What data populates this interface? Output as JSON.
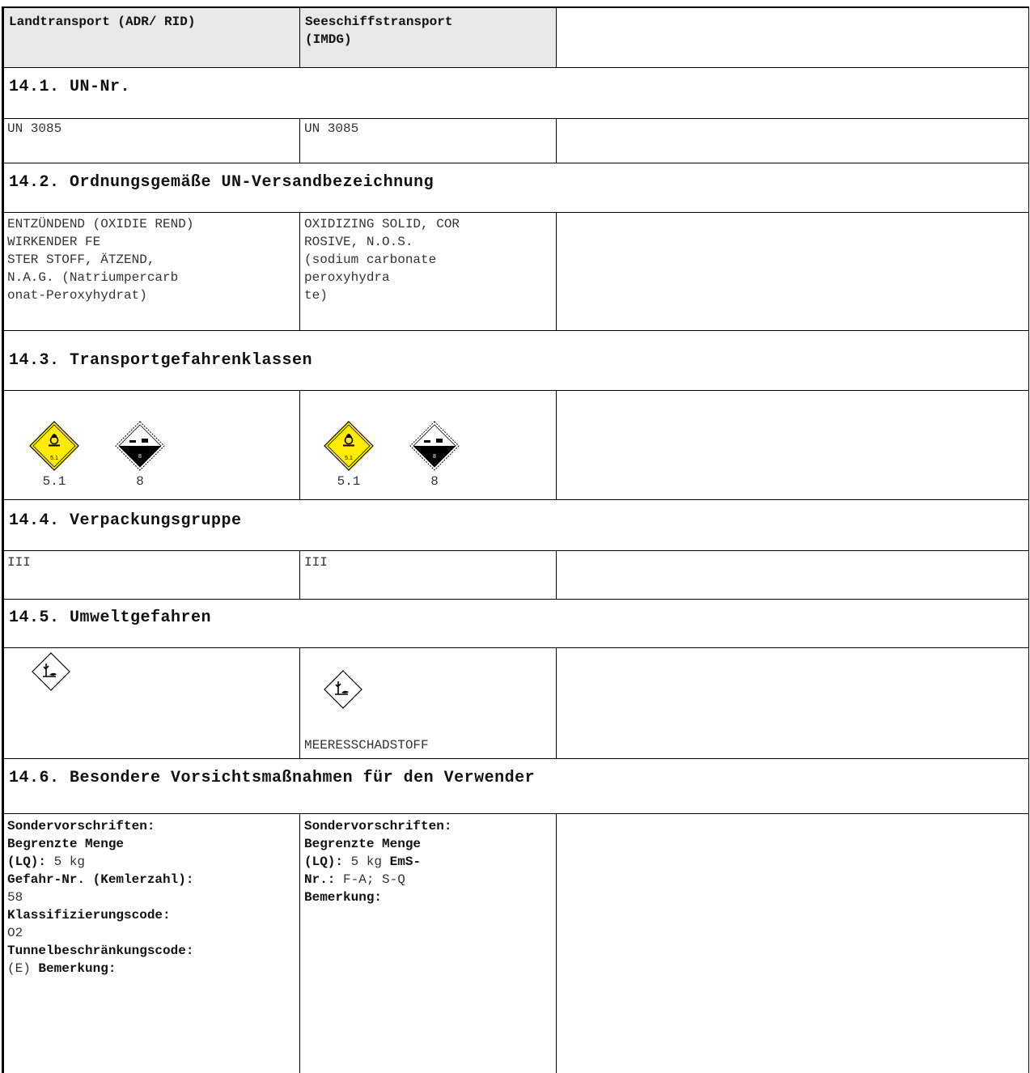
{
  "columns": {
    "land": "Landtransport (ADR/ RID)",
    "sea": "Seeschiffstransport\n(IMDG)"
  },
  "sections": {
    "un_nr": {
      "title": "14.1. UN-Nr.",
      "land": "UN 3085",
      "sea": "UN 3085"
    },
    "shipping_name": {
      "title": "14.2. Ordnungsgemäße UN-Versandbezeichnung",
      "land": "ENTZÜNDEND (OXIDIE REND)\nWIRKENDER FE\nSTER STOFF, ÄTZEND,\nN.A.G. (Natriumpercarb\nonat-Peroxyhydrat)",
      "sea": "OXIDIZING SOLID, COR\nROSIVE, N.O.S.\n(sodium carbonate\nperoxyhydra\nte)"
    },
    "hazard_classes": {
      "title": "14.3. Transportgefahrenklassen",
      "land_codes": [
        "5.1",
        "8"
      ],
      "sea_codes": [
        "5.1",
        "8"
      ],
      "pictograms": [
        "oxidizer-5-1-icon",
        "corrosive-8-icon"
      ]
    },
    "packing_group": {
      "title": "14.4. Verpackungsgruppe",
      "land": "III",
      "sea": "III"
    },
    "environment": {
      "title": "14.5. Umweltgefahren",
      "sea_label": "MEERESSCHADSTOFF",
      "pictogram": "environment-hazard-icon"
    },
    "precautions": {
      "title": "14.6. Besondere Vorsichtsmaßnahmen für den Verwender",
      "land": {
        "special_provisions_label": "Sondervorschriften:",
        "limited_qty_label_1": "Begrenzte Menge",
        "limited_qty_label_2": "(LQ):",
        "limited_qty_value": "5 kg",
        "hazard_no_label": "Gefahr-Nr. (Kemlerzahl):",
        "hazard_no_value": "58",
        "classification_label": "Klassifizierungscode:",
        "classification_value": "O2",
        "tunnel_label": "Tunnelbeschränkungscode:",
        "tunnel_value": "(E)",
        "remark_label": "Bemerkung:"
      },
      "sea": {
        "special_provisions_label": "Sondervorschriften:",
        "limited_qty_label_1": "Begrenzte Menge",
        "limited_qty_label_2": "(LQ):",
        "limited_qty_value": "5 kg",
        "ems_label_1": "EmS-",
        "ems_label_2": "Nr.:",
        "ems_value": "F-A; S-Q",
        "remark_label": "Bemerkung:"
      }
    }
  },
  "colors": {
    "header_bg": "#e8e8e8",
    "oxidizer_yellow": "#ffec00",
    "border": "#000000"
  }
}
